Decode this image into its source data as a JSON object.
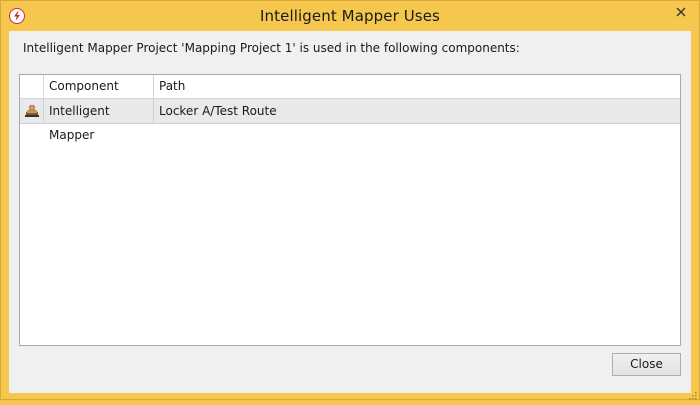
{
  "window": {
    "title": "Intelligent Mapper Uses",
    "icon": "app-lightning-icon",
    "close_icon": "close-icon"
  },
  "description": "Intelligent Mapper Project 'Mapping Project 1' is used in the following components:",
  "table": {
    "columns": [
      "Component",
      "Path"
    ],
    "rows": [
      {
        "icon": "intelligent-mapper-icon",
        "component": "Intelligent Mapper",
        "path": "Locker A/Test Route"
      }
    ]
  },
  "buttons": {
    "close_label": "Close"
  },
  "colors": {
    "titlebar": "#f5c74e",
    "client": "#f0f0f0",
    "row_selected": "#e9e9e9"
  }
}
